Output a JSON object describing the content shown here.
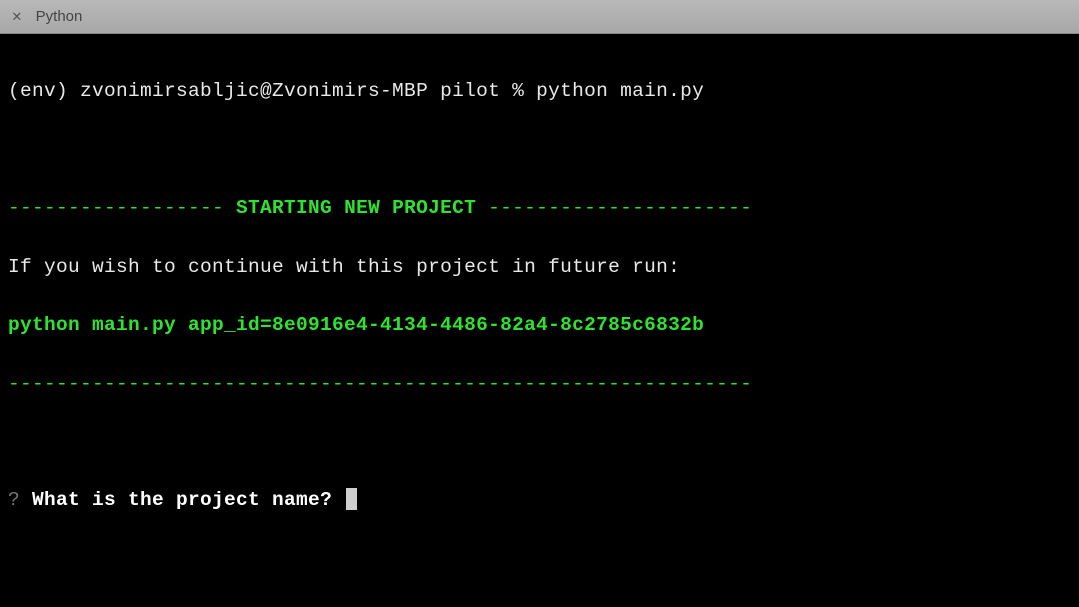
{
  "window": {
    "title": "Python"
  },
  "terminal": {
    "prompt": "(env) zvonimirsabljic@Zvonimirs-MBP pilot % python main.py",
    "banner_left": "------------------ ",
    "banner_title": "STARTING NEW PROJECT",
    "banner_right": " ----------------------",
    "continue_msg": "If you wish to continue with this project in future run:",
    "continue_cmd": "python main.py app_id=8e0916e4-4134-4486-82a4-8c2785c6832b",
    "divider": "--------------------------------------------------------------",
    "question_mark": "?",
    "question": " What is the project name? "
  }
}
